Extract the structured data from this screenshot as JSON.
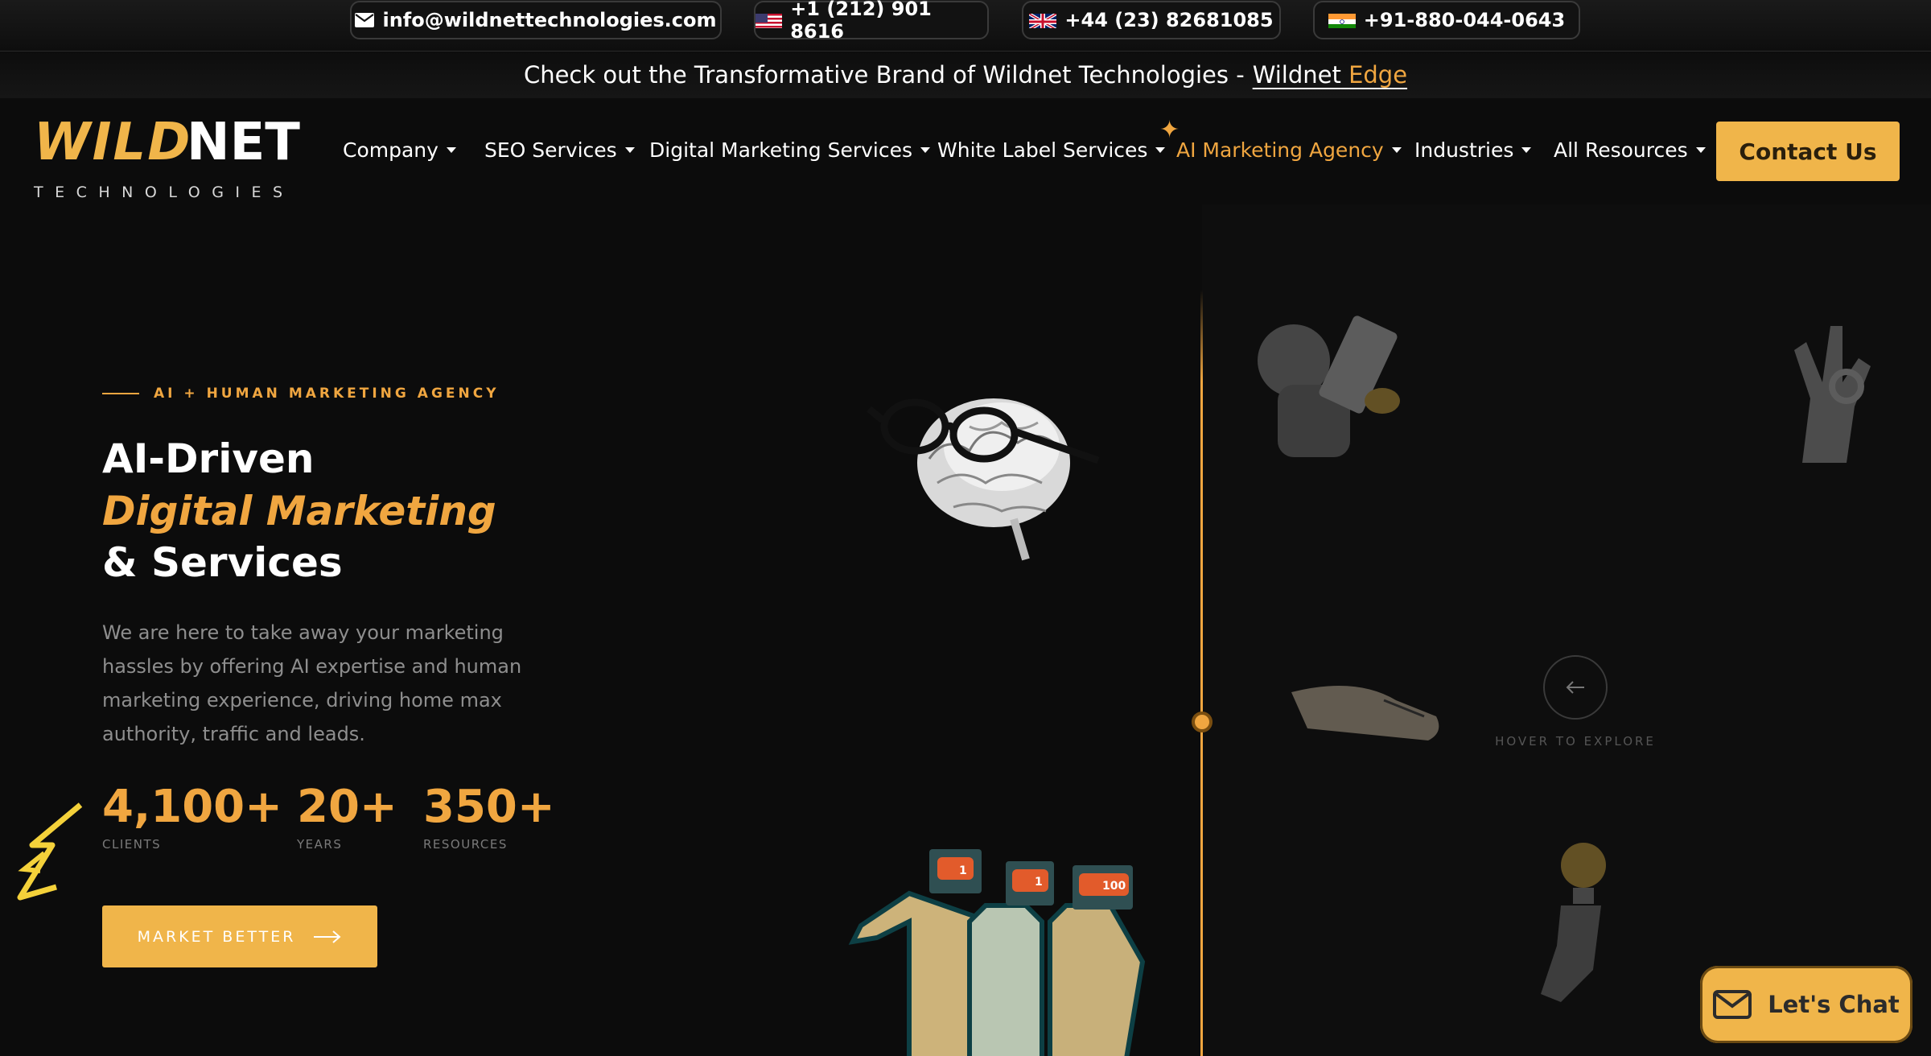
{
  "topbar": {
    "email": "info@wildnettechnologies.com",
    "phone_us": "+1 (212) 901 8616",
    "phone_uk": "+44 (23) 82681085",
    "phone_in": "+91-880-044-0643"
  },
  "announcement": {
    "text": "Check out the Transformative Brand of Wildnet Technologies -",
    "link_part1": "Wildnet",
    "link_part2": "Edge"
  },
  "logo": {
    "wild": "WILD",
    "net": "NET",
    "tag": "TECHNOLOGIES"
  },
  "nav": {
    "items": [
      {
        "label": "Company"
      },
      {
        "label": "SEO Services"
      },
      {
        "label": "Digital Marketing Services"
      },
      {
        "label": "White Label Services"
      },
      {
        "label": "AI Marketing Agency"
      },
      {
        "label": "Industries"
      },
      {
        "label": "All Resources"
      }
    ],
    "contact_label": "Contact Us"
  },
  "hero": {
    "eyebrow": "AI + HUMAN MARKETING AGENCY",
    "title_line1": "AI-Driven",
    "title_line2": "Digital Marketing",
    "title_line3": "& Services",
    "lead": "We are here to take away your marketing hassles by offering AI expertise and human marketing experience, driving home max authority, traffic and leads.",
    "stats": [
      {
        "value": "4,100+",
        "label": "CLIENTS"
      },
      {
        "value": "20+",
        "label": "YEARS"
      },
      {
        "value": "350+",
        "label": "RESOURCES"
      }
    ],
    "cta_label": "MARKET BETTER",
    "hover_hint": "HOVER TO EXPLORE",
    "badges": [
      "1",
      "1",
      "100"
    ]
  },
  "chat": {
    "label": "Let's Chat"
  },
  "colors": {
    "accent": "#f0a640",
    "button": "#f0b54a",
    "background": "#0c0c0c"
  }
}
